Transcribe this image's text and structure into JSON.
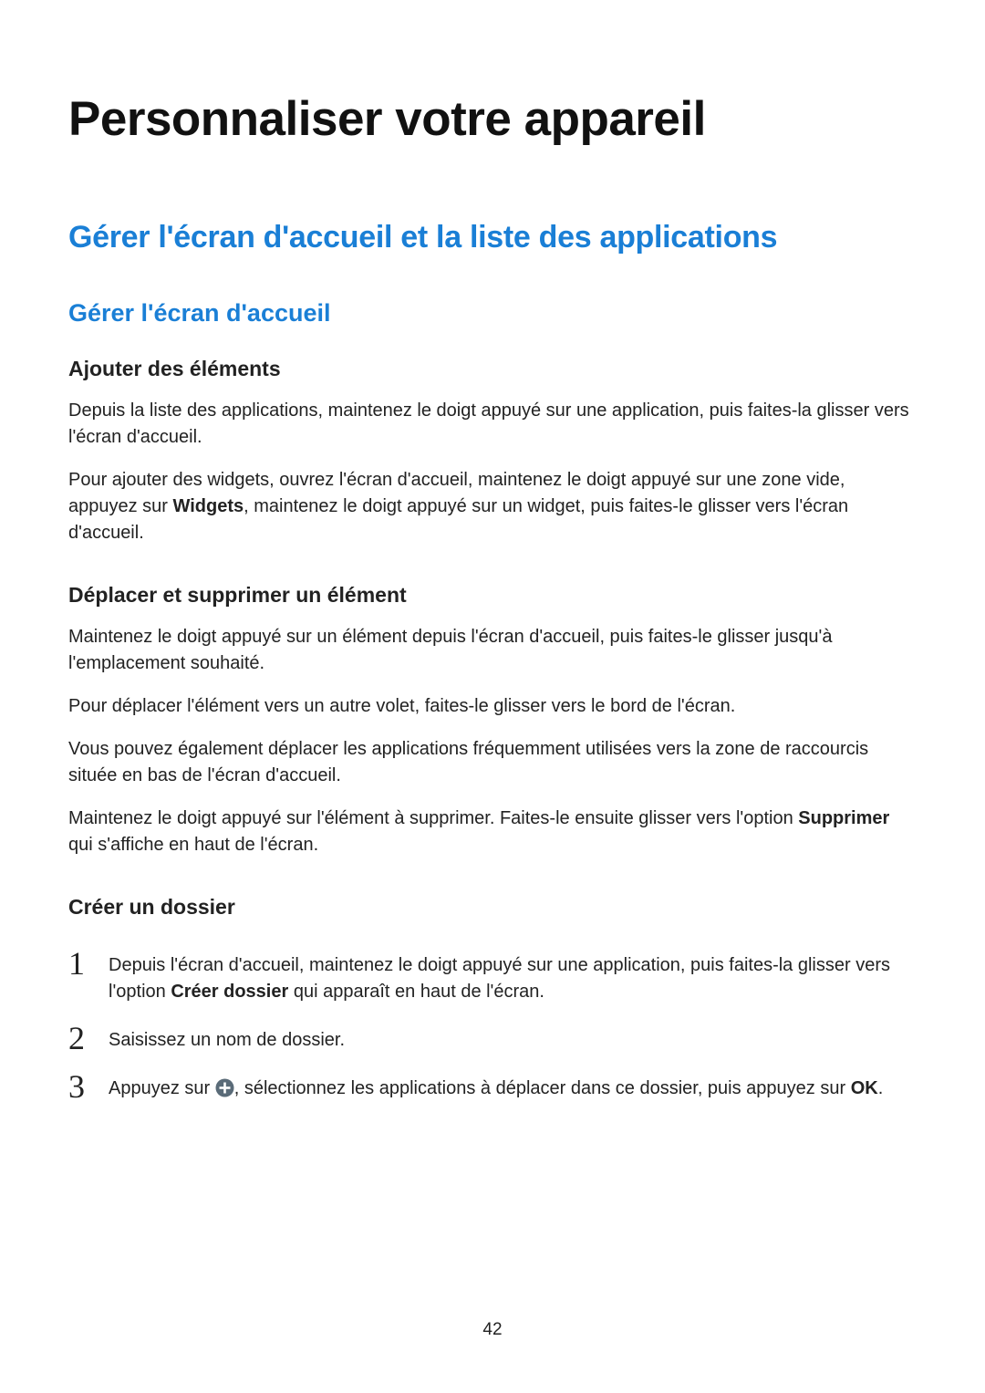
{
  "page_title": "Personnaliser votre appareil",
  "section_heading": "Gérer l'écran d'accueil et la liste des applications",
  "subsection_heading": "Gérer l'écran d'accueil",
  "block1": {
    "heading": "Ajouter des éléments",
    "p1": "Depuis la liste des applications, maintenez le doigt appuyé sur une application, puis faites-la glisser vers l'écran d'accueil.",
    "p2a": "Pour ajouter des widgets, ouvrez l'écran d'accueil, maintenez le doigt appuyé sur une zone vide, appuyez sur ",
    "p2_bold": "Widgets",
    "p2b": ", maintenez le doigt appuyé sur un widget, puis faites-le glisser vers l'écran d'accueil."
  },
  "block2": {
    "heading": "Déplacer et supprimer un élément",
    "p1": "Maintenez le doigt appuyé sur un élément depuis l'écran d'accueil, puis faites-le glisser jusqu'à l'emplacement souhaité.",
    "p2": "Pour déplacer l'élément vers un autre volet, faites-le glisser vers le bord de l'écran.",
    "p3": "Vous pouvez également déplacer les applications fréquemment utilisées vers la zone de raccourcis située en bas de l'écran d'accueil.",
    "p4a": "Maintenez le doigt appuyé sur l'élément à supprimer. Faites-le ensuite glisser vers l'option ",
    "p4_bold": "Supprimer",
    "p4b": " qui s'affiche en haut de l'écran."
  },
  "block3": {
    "heading": "Créer un dossier",
    "steps": {
      "n1": "1",
      "s1a": "Depuis l'écran d'accueil, maintenez le doigt appuyé sur une application, puis faites-la glisser vers l'option ",
      "s1_bold": "Créer dossier",
      "s1b": " qui apparaît en haut de l'écran.",
      "n2": "2",
      "s2": "Saisissez un nom de dossier.",
      "n3": "3",
      "s3a": "Appuyez sur ",
      "s3b": ", sélectionnez les applications à déplacer dans ce dossier, puis appuyez sur ",
      "s3_bold": "OK",
      "s3c": "."
    }
  },
  "page_number": "42"
}
